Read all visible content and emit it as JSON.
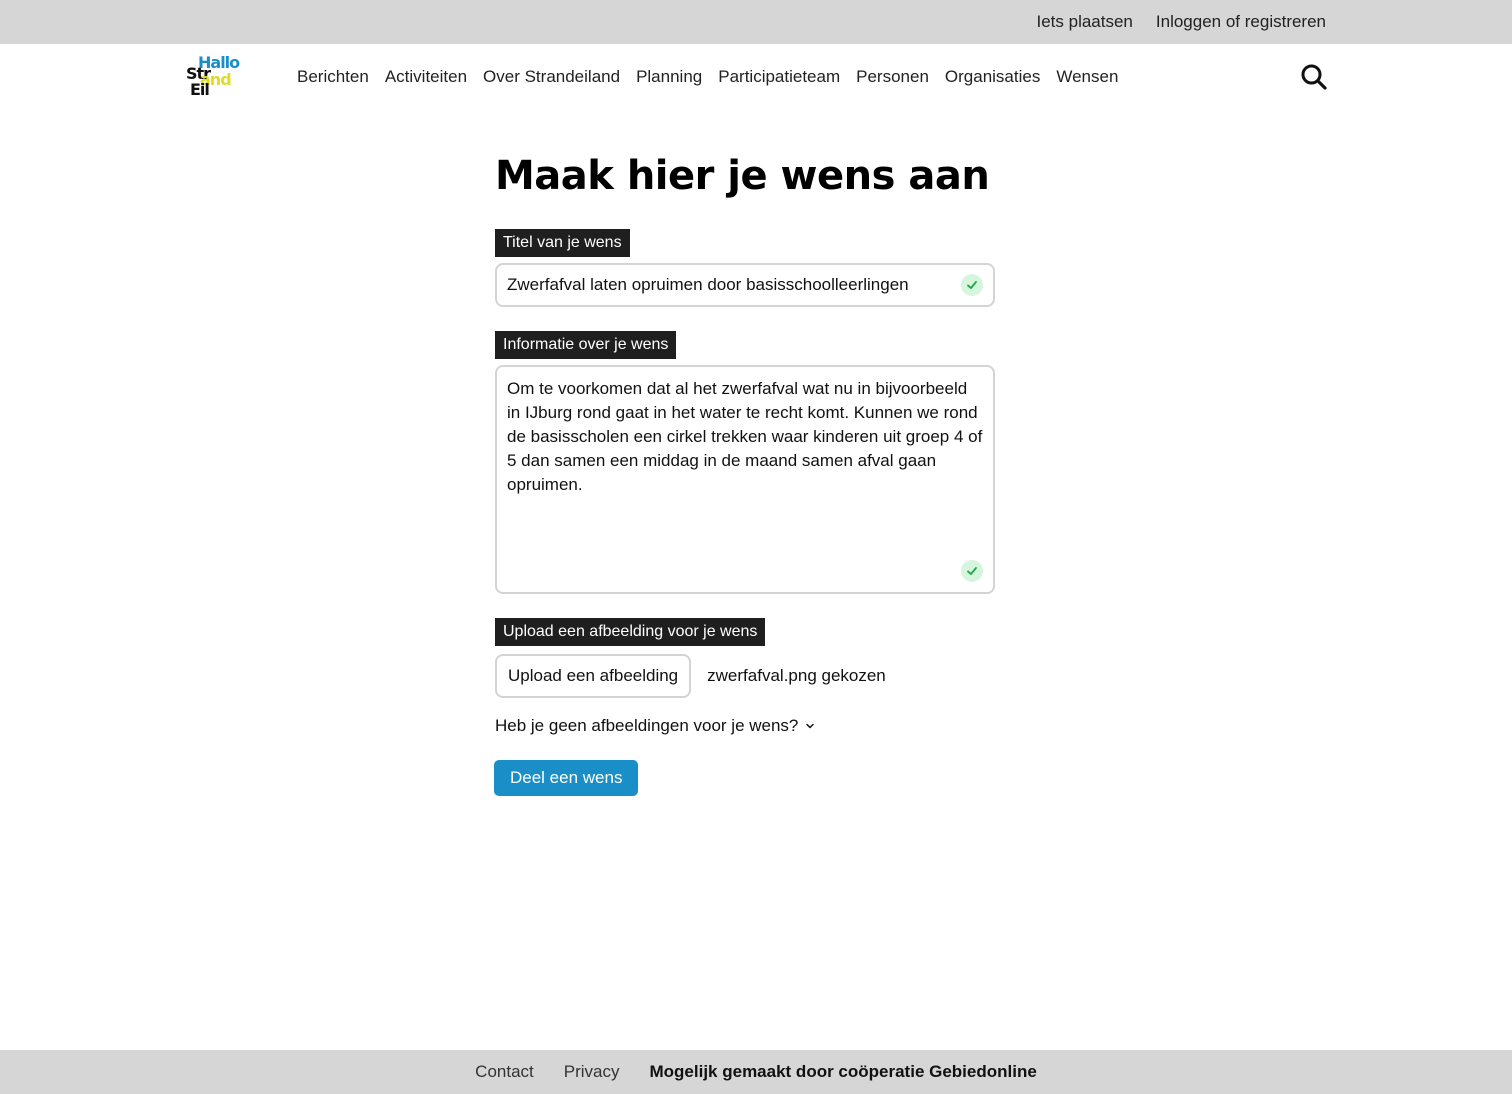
{
  "topbar": {
    "post_link": "Iets plaatsen",
    "login_link": "Inloggen of registreren"
  },
  "logo": {
    "line1": "Hallo",
    "line2": "Str",
    "line3": "and",
    "line4": "Eil"
  },
  "nav": {
    "items": [
      {
        "label": "Berichten"
      },
      {
        "label": "Activiteiten"
      },
      {
        "label": "Over Strandeiland"
      },
      {
        "label": "Planning"
      },
      {
        "label": "Participatieteam"
      },
      {
        "label": "Personen"
      },
      {
        "label": "Organisaties"
      },
      {
        "label": "Wensen"
      }
    ],
    "search_icon": "search-icon"
  },
  "form": {
    "heading": "Maak hier je wens aan",
    "title_label": "Titel van je wens",
    "title_value": "Zwerfafval laten opruimen door basisschoolleerlingen",
    "info_label": "Informatie over je wens",
    "info_value": "Om te voorkomen dat al het zwerfafval wat nu in bijvoorbeeld in IJburg rond gaat in het water te recht komt. Kunnen we rond de basisscholen een cirkel trekken waar kinderen uit groep 4 of 5 dan samen een middag in de maand samen afval gaan opruimen.",
    "upload_label": "Upload een afbeelding voor je wens",
    "upload_button": "Upload een afbeelding",
    "upload_status": "zwerfafval.png gekozen",
    "no_image_toggle": "Heb je geen afbeeldingen voor je wens?",
    "submit_button": "Deel een wens"
  },
  "footer": {
    "contact": "Contact",
    "privacy": "Privacy",
    "credit": "Mogelijk gemaakt door coöperatie Gebiedonline"
  },
  "colors": {
    "accent": "#1a8fc7",
    "logo_yellow": "#e0dd1e",
    "bar_gray": "#d6d6d6",
    "valid_green": "#22a745"
  }
}
